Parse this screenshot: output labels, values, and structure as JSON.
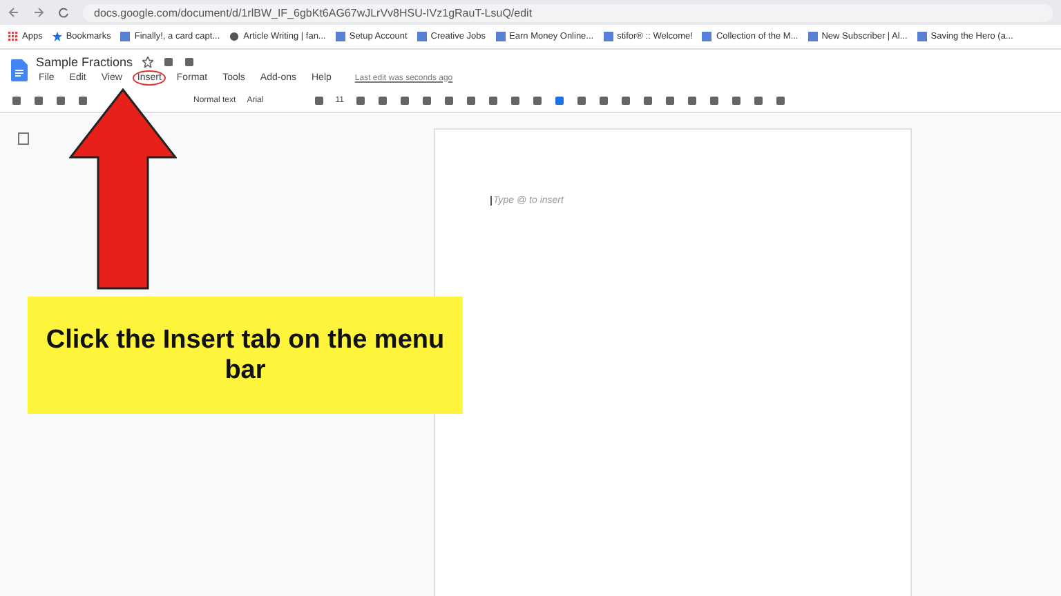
{
  "browser": {
    "url": "docs.google.com/document/d/1rlBW_IF_6gbKt6AG67wJLrVv8HSU-IVz1gRauT-LsuQ/edit"
  },
  "bookmarks": [
    {
      "label": "Apps",
      "kind": "apps"
    },
    {
      "label": "Bookmarks",
      "kind": "star"
    },
    {
      "label": "Finally!, a card capt...",
      "kind": "square"
    },
    {
      "label": "Article Writing | fan...",
      "kind": "globe"
    },
    {
      "label": "Setup Account",
      "kind": "square"
    },
    {
      "label": "Creative Jobs",
      "kind": "square"
    },
    {
      "label": "Earn Money Online...",
      "kind": "square"
    },
    {
      "label": "stifor® :: Welcome!",
      "kind": "square"
    },
    {
      "label": "Collection of the M...",
      "kind": "square"
    },
    {
      "label": "New Subscriber | Al...",
      "kind": "square"
    },
    {
      "label": "Saving the Hero (a...",
      "kind": "square"
    }
  ],
  "document": {
    "title": "Sample Fractions",
    "last_edit": "Last edit was seconds ago",
    "placeholder": "Type @ to insert"
  },
  "menu": [
    {
      "label": "File",
      "highlighted": false
    },
    {
      "label": "Edit",
      "highlighted": false
    },
    {
      "label": "View",
      "highlighted": false
    },
    {
      "label": "Insert",
      "highlighted": true
    },
    {
      "label": "Format",
      "highlighted": false
    },
    {
      "label": "Tools",
      "highlighted": false
    },
    {
      "label": "Add-ons",
      "highlighted": false
    },
    {
      "label": "Help",
      "highlighted": false
    }
  ],
  "toolbar": {
    "style": "Normal text",
    "font": "Arial",
    "size": "11"
  },
  "callout": {
    "text": "Click the Insert tab on the menu bar"
  }
}
